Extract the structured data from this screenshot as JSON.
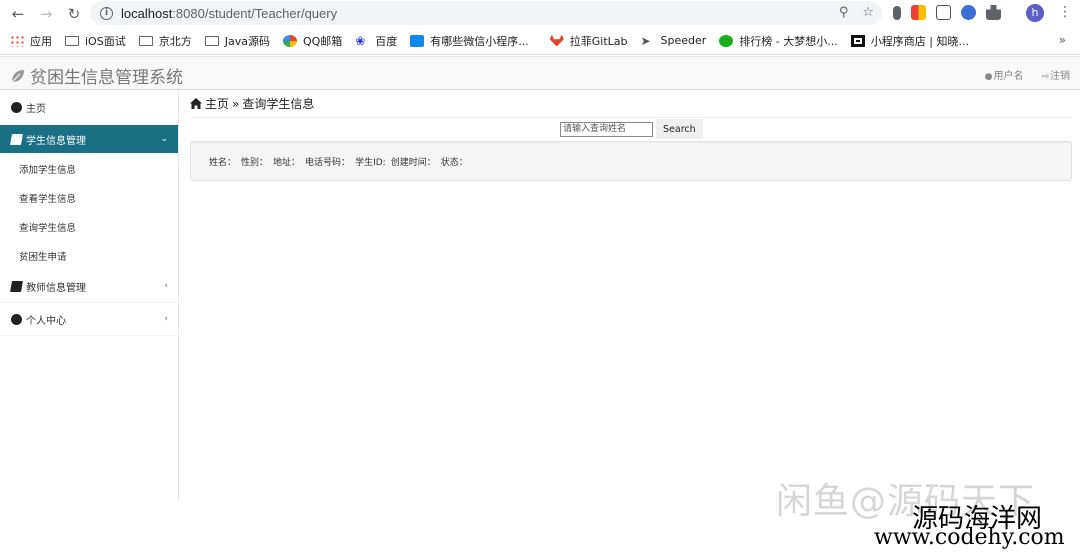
{
  "browser": {
    "url_host": "localhost",
    "url_path": ":8080/student/Teacher/query",
    "profile_initial": "h",
    "bookmarks": [
      {
        "label": "应用",
        "icon": "apps-grid-icon"
      },
      {
        "label": "iOS面试",
        "icon": "folder-icon"
      },
      {
        "label": "京北方",
        "icon": "folder-icon"
      },
      {
        "label": "Java源码",
        "icon": "folder-icon"
      },
      {
        "label": "QQ邮箱",
        "icon": "qq-mail-icon"
      },
      {
        "label": "百度",
        "icon": "baidu-paw-icon"
      },
      {
        "label": "有哪些微信小程序...",
        "icon": "zhihu-icon"
      },
      {
        "label": "拉菲GitLab",
        "icon": "gitlab-icon"
      },
      {
        "label": "Speeder",
        "icon": "rocket-icon"
      },
      {
        "label": "排行榜 - 大梦想小...",
        "icon": "leaderboard-icon"
      },
      {
        "label": "小程序商店 | 知晓...",
        "icon": "qr-icon"
      }
    ],
    "bookmarks_more": "»"
  },
  "header": {
    "brand": "贫困生信息管理系统",
    "user": "用户名",
    "logout": "注销"
  },
  "sidebar": {
    "home": "主页",
    "student_group": "学生信息管理",
    "student_items": [
      "添加学生信息",
      "查看学生信息",
      "查询学生信息",
      "贫困生申请"
    ],
    "teacher_group": "教师信息管理",
    "personal_group": "个人中心"
  },
  "breadcrumb": {
    "home": "主页",
    "separator": "»",
    "current": "查询学生信息"
  },
  "search": {
    "placeholder": "请输入查询姓名",
    "button": "Search"
  },
  "result": {
    "fields": [
      "姓名：",
      "性别：",
      "地址：",
      "电话号码：",
      "学生ID:",
      "创建时间：",
      "状态："
    ]
  },
  "watermark": {
    "line1": "闲鱼@源码天下",
    "line2": "源码海洋网",
    "line3": "www.codehy.com"
  },
  "colors": {
    "sidebar_active": "#196f84",
    "header_bg": "#f8f8f8",
    "panel_bg": "#f5f5f5"
  }
}
